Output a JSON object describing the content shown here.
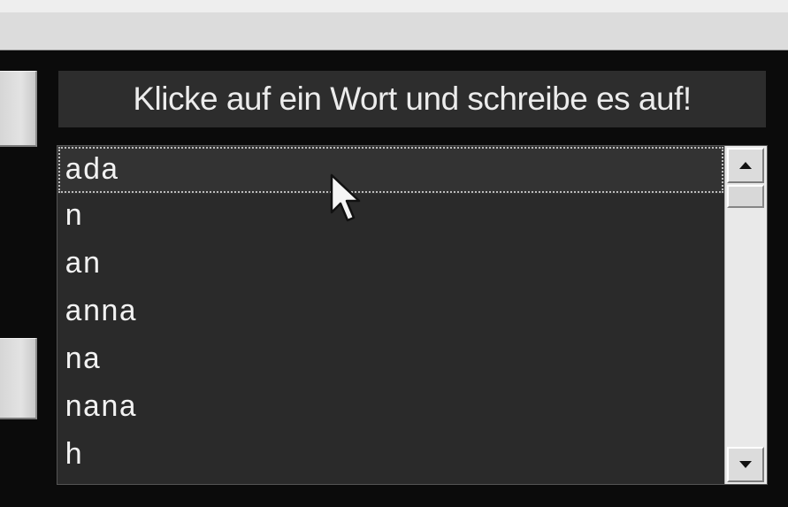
{
  "instruction": {
    "text": "Klicke auf ein Wort und schreibe es auf!"
  },
  "word_list": {
    "items": [
      {
        "label": "ada",
        "selected": true
      },
      {
        "label": "n",
        "selected": false
      },
      {
        "label": "an",
        "selected": false
      },
      {
        "label": "anna",
        "selected": false
      },
      {
        "label": "na",
        "selected": false
      },
      {
        "label": "nana",
        "selected": false
      },
      {
        "label": "h",
        "selected": false
      }
    ]
  },
  "icons": {
    "scroll_up": "arrow-up-icon",
    "scroll_down": "arrow-down-icon",
    "cursor": "mouse-pointer-icon"
  },
  "colors": {
    "background": "#0b0b0b",
    "panel": "#2a2a2a",
    "text": "#f2f2f2",
    "scrollbar": "#e9e9e9"
  }
}
